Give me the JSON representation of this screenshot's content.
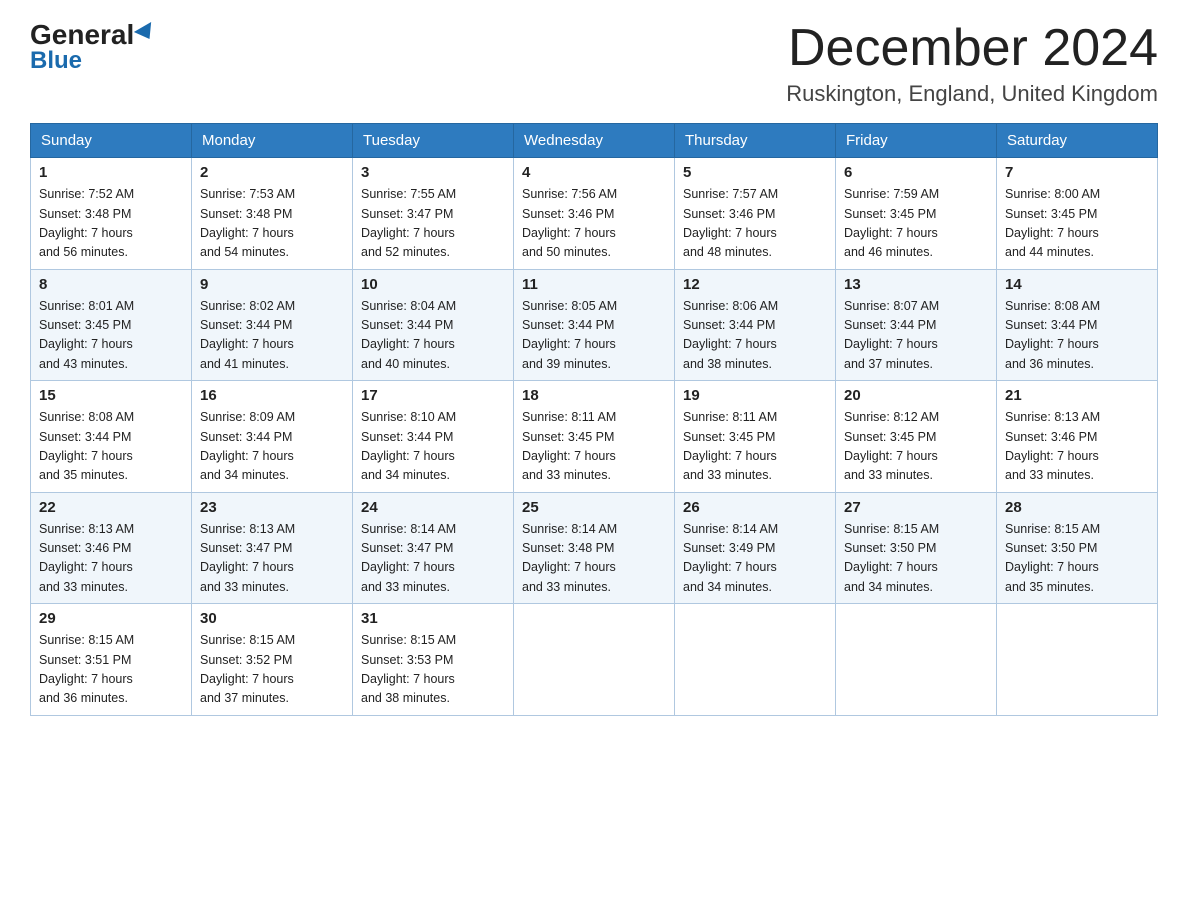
{
  "header": {
    "logo_general": "General",
    "logo_blue": "Blue",
    "month_title": "December 2024",
    "location": "Ruskington, England, United Kingdom"
  },
  "days_of_week": [
    "Sunday",
    "Monday",
    "Tuesday",
    "Wednesday",
    "Thursday",
    "Friday",
    "Saturday"
  ],
  "weeks": [
    [
      {
        "day": "1",
        "sunrise": "7:52 AM",
        "sunset": "3:48 PM",
        "daylight": "7 hours and 56 minutes."
      },
      {
        "day": "2",
        "sunrise": "7:53 AM",
        "sunset": "3:48 PM",
        "daylight": "7 hours and 54 minutes."
      },
      {
        "day": "3",
        "sunrise": "7:55 AM",
        "sunset": "3:47 PM",
        "daylight": "7 hours and 52 minutes."
      },
      {
        "day": "4",
        "sunrise": "7:56 AM",
        "sunset": "3:46 PM",
        "daylight": "7 hours and 50 minutes."
      },
      {
        "day": "5",
        "sunrise": "7:57 AM",
        "sunset": "3:46 PM",
        "daylight": "7 hours and 48 minutes."
      },
      {
        "day": "6",
        "sunrise": "7:59 AM",
        "sunset": "3:45 PM",
        "daylight": "7 hours and 46 minutes."
      },
      {
        "day": "7",
        "sunrise": "8:00 AM",
        "sunset": "3:45 PM",
        "daylight": "7 hours and 44 minutes."
      }
    ],
    [
      {
        "day": "8",
        "sunrise": "8:01 AM",
        "sunset": "3:45 PM",
        "daylight": "7 hours and 43 minutes."
      },
      {
        "day": "9",
        "sunrise": "8:02 AM",
        "sunset": "3:44 PM",
        "daylight": "7 hours and 41 minutes."
      },
      {
        "day": "10",
        "sunrise": "8:04 AM",
        "sunset": "3:44 PM",
        "daylight": "7 hours and 40 minutes."
      },
      {
        "day": "11",
        "sunrise": "8:05 AM",
        "sunset": "3:44 PM",
        "daylight": "7 hours and 39 minutes."
      },
      {
        "day": "12",
        "sunrise": "8:06 AM",
        "sunset": "3:44 PM",
        "daylight": "7 hours and 38 minutes."
      },
      {
        "day": "13",
        "sunrise": "8:07 AM",
        "sunset": "3:44 PM",
        "daylight": "7 hours and 37 minutes."
      },
      {
        "day": "14",
        "sunrise": "8:08 AM",
        "sunset": "3:44 PM",
        "daylight": "7 hours and 36 minutes."
      }
    ],
    [
      {
        "day": "15",
        "sunrise": "8:08 AM",
        "sunset": "3:44 PM",
        "daylight": "7 hours and 35 minutes."
      },
      {
        "day": "16",
        "sunrise": "8:09 AM",
        "sunset": "3:44 PM",
        "daylight": "7 hours and 34 minutes."
      },
      {
        "day": "17",
        "sunrise": "8:10 AM",
        "sunset": "3:44 PM",
        "daylight": "7 hours and 34 minutes."
      },
      {
        "day": "18",
        "sunrise": "8:11 AM",
        "sunset": "3:45 PM",
        "daylight": "7 hours and 33 minutes."
      },
      {
        "day": "19",
        "sunrise": "8:11 AM",
        "sunset": "3:45 PM",
        "daylight": "7 hours and 33 minutes."
      },
      {
        "day": "20",
        "sunrise": "8:12 AM",
        "sunset": "3:45 PM",
        "daylight": "7 hours and 33 minutes."
      },
      {
        "day": "21",
        "sunrise": "8:13 AM",
        "sunset": "3:46 PM",
        "daylight": "7 hours and 33 minutes."
      }
    ],
    [
      {
        "day": "22",
        "sunrise": "8:13 AM",
        "sunset": "3:46 PM",
        "daylight": "7 hours and 33 minutes."
      },
      {
        "day": "23",
        "sunrise": "8:13 AM",
        "sunset": "3:47 PM",
        "daylight": "7 hours and 33 minutes."
      },
      {
        "day": "24",
        "sunrise": "8:14 AM",
        "sunset": "3:47 PM",
        "daylight": "7 hours and 33 minutes."
      },
      {
        "day": "25",
        "sunrise": "8:14 AM",
        "sunset": "3:48 PM",
        "daylight": "7 hours and 33 minutes."
      },
      {
        "day": "26",
        "sunrise": "8:14 AM",
        "sunset": "3:49 PM",
        "daylight": "7 hours and 34 minutes."
      },
      {
        "day": "27",
        "sunrise": "8:15 AM",
        "sunset": "3:50 PM",
        "daylight": "7 hours and 34 minutes."
      },
      {
        "day": "28",
        "sunrise": "8:15 AM",
        "sunset": "3:50 PM",
        "daylight": "7 hours and 35 minutes."
      }
    ],
    [
      {
        "day": "29",
        "sunrise": "8:15 AM",
        "sunset": "3:51 PM",
        "daylight": "7 hours and 36 minutes."
      },
      {
        "day": "30",
        "sunrise": "8:15 AM",
        "sunset": "3:52 PM",
        "daylight": "7 hours and 37 minutes."
      },
      {
        "day": "31",
        "sunrise": "8:15 AM",
        "sunset": "3:53 PM",
        "daylight": "7 hours and 38 minutes."
      },
      null,
      null,
      null,
      null
    ]
  ],
  "labels": {
    "sunrise": "Sunrise:",
    "sunset": "Sunset:",
    "daylight": "Daylight:"
  }
}
